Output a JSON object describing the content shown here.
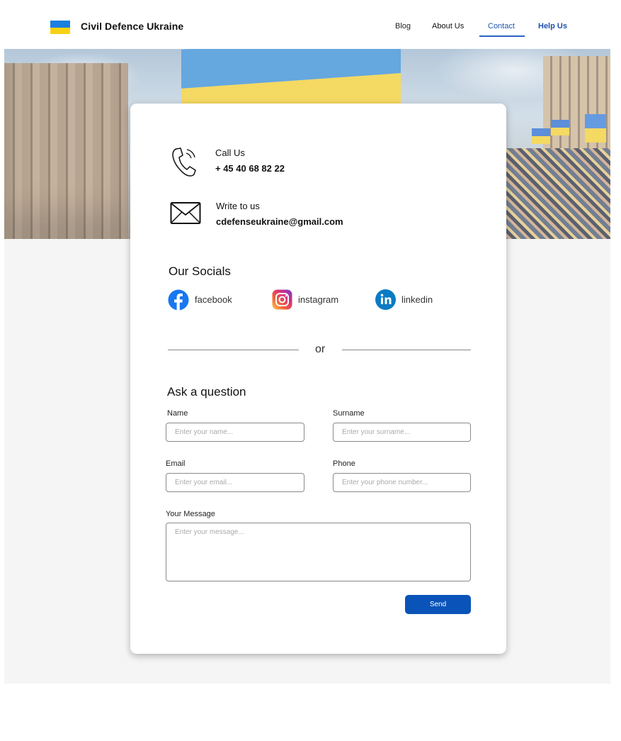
{
  "header": {
    "brand": "Civil Defence Ukraine",
    "nav": [
      "Blog",
      "About Us",
      "Contact",
      "Help Us"
    ],
    "active_nav": "Contact"
  },
  "contact": {
    "call_label": "Call Us",
    "phone": "+ 45 40 68 82 22",
    "write_label": "Write to us",
    "email": "cdefenseukraine@gmail.com"
  },
  "socials": {
    "title": "Our Socials",
    "items": [
      {
        "name": "facebook",
        "icon": "facebook-icon",
        "color": "#1877F2"
      },
      {
        "name": "instagram",
        "icon": "instagram-icon",
        "color": "#E1306C"
      },
      {
        "name": "linkedin",
        "icon": "linkedin-icon",
        "color": "#0A66C2"
      }
    ]
  },
  "divider_text": "or",
  "form": {
    "title": "Ask a question",
    "name_label": "Name",
    "name_placeholder": "Enter your name...",
    "surname_label": "Surname",
    "surname_placeholder": "Enter your surname...",
    "email_label": "Email",
    "email_placeholder": "Enter your email...",
    "phone_label": "Phone",
    "phone_placeholder": "Enter your phone number...",
    "message_label": "Your Message",
    "message_placeholder": "Enter your message...",
    "send_label": "Send"
  },
  "colors": {
    "accent": "#0A53B8",
    "flag_blue": "#1A7FE0",
    "flag_yellow": "#F7D112"
  }
}
